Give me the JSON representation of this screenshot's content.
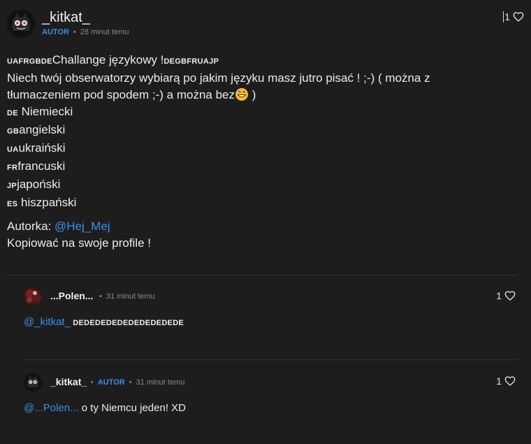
{
  "post": {
    "username": "_kitkat_",
    "badge": "AUTOR",
    "time": "28 minut temu",
    "likes": "1",
    "title_flags": "UAFRGBDE",
    "title": "Challange językowy !",
    "title_flags_after": "DEGBFRUAJP",
    "line2": "Niech twój obserwatorzy wybiarą po jakim języku masz jutro pisać ! ;-) ( można z",
    "line3": "tłumaczeniem pod spodem ;-) a można bez",
    "line3_end": " )",
    "languages": [
      {
        "code": "DE",
        "name": " Niemiecki"
      },
      {
        "code": "GB",
        "name": "angielski"
      },
      {
        "code": "UA",
        "name": "ukraiński"
      },
      {
        "code": "FR",
        "name": "francuski"
      },
      {
        "code": "JP",
        "name": "japoński"
      },
      {
        "code": "ES",
        "name": " hiszpański"
      }
    ],
    "author_label": "Autorka: ",
    "author_mention": "@Hej_Mej",
    "closing": "Kopiować na swoje profile !"
  },
  "replies": [
    {
      "username": "...Polen...",
      "time": "31 minut temu",
      "likes": "1",
      "mention": "@_kitkat_",
      "text": " DEDEDEDEDEDEDEDEDEDE"
    },
    {
      "username": "_kitkat_",
      "badge": "AUTOR",
      "time": "31 minut temu",
      "likes": "1",
      "mention": "@...Polen...",
      "text": " o ty Niemcu jeden! XD"
    }
  ],
  "colors": {
    "background": "#1d1d1d",
    "accent": "#3d8fe6",
    "muted": "#8a8a8a"
  },
  "icons": [
    "heart-icon",
    "grinning-emoji-icon",
    "avatar-cat-icon",
    "avatar-polen-icon"
  ]
}
